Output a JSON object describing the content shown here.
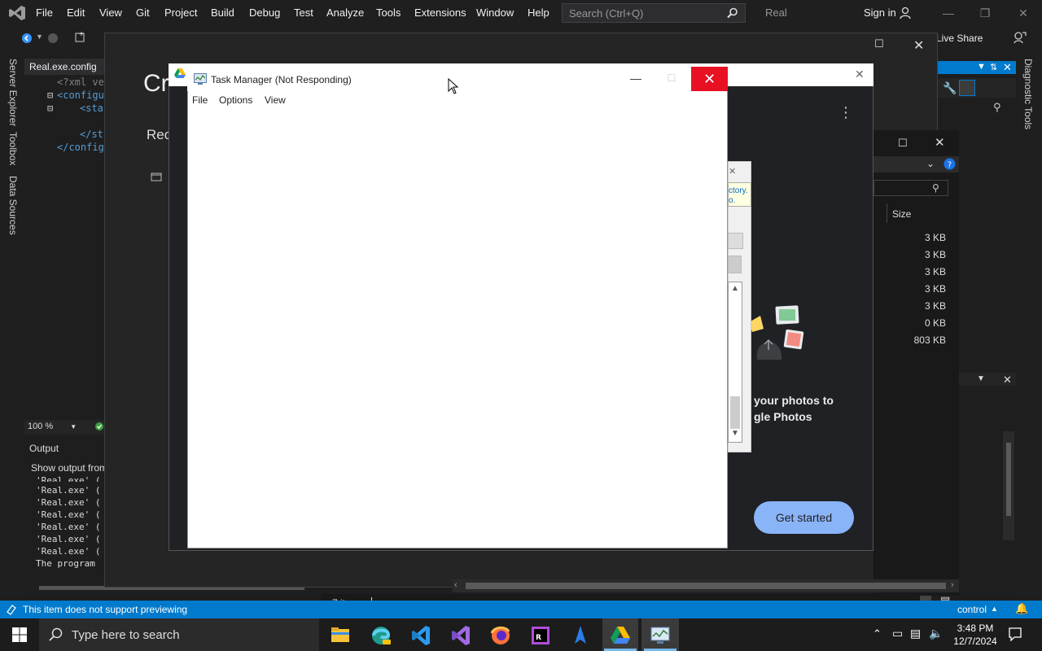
{
  "vs": {
    "menu": [
      "File",
      "Edit",
      "View",
      "Git",
      "Project",
      "Build",
      "Debug",
      "Test",
      "Analyze",
      "Tools",
      "Extensions",
      "Window",
      "Help"
    ],
    "search_placeholder": "Search (Ctrl+Q)",
    "solution_name": "Real",
    "sign_in": "Sign in",
    "live_share": "Live Share",
    "side_tabs_left": [
      "Server Explorer",
      "Toolbox",
      "Data Sources"
    ],
    "side_tabs_right": [
      "Diagnostic Tools"
    ],
    "editor_tab": "Real.exe.config",
    "code_lines": [
      "<?xml ve",
      "<configu",
      "<sta",
      "</st",
      "</config"
    ],
    "zoom": "100 %",
    "output_title": "Output",
    "output_show": "Show output from",
    "output_lines": [
      "'Real.exe' (",
      "'Real.exe' (",
      "'Real.exe' (",
      "'Real.exe' (",
      "'Real.exe' (",
      "'Real.exe' (",
      "The program"
    ],
    "status_text": "This item does not support previewing",
    "status_right": "control"
  },
  "dialog": {
    "title_fragment": "Cr",
    "subtitle_fragment": "Rec"
  },
  "photos": {
    "text_line1": "your photos to",
    "text_line2": "gle Photos",
    "button": "Get started",
    "tooltip_fragment1": "ctory.",
    "tooltip_fragment2": "o."
  },
  "explorer": {
    "size_header": "Size",
    "sizes": [
      "3 KB",
      "3 KB",
      "3 KB",
      "3 KB",
      "3 KB",
      "0 KB",
      "803 KB"
    ],
    "items_count": "7 items"
  },
  "task_manager": {
    "title": "Task Manager (Not Responding)",
    "menu": [
      "File",
      "Options",
      "View"
    ]
  },
  "taskbar": {
    "search_placeholder": "Type here to search",
    "time": "3:48 PM",
    "date": "12/7/2024",
    "apps": [
      "file-explorer",
      "edge",
      "vscode",
      "visual-studio",
      "firefox",
      "rider",
      "app-blue",
      "google-drive",
      "task-manager"
    ]
  },
  "colors": {
    "accent": "#007acc",
    "close_red": "#e81123",
    "photos_button": "#8ab4f8"
  }
}
